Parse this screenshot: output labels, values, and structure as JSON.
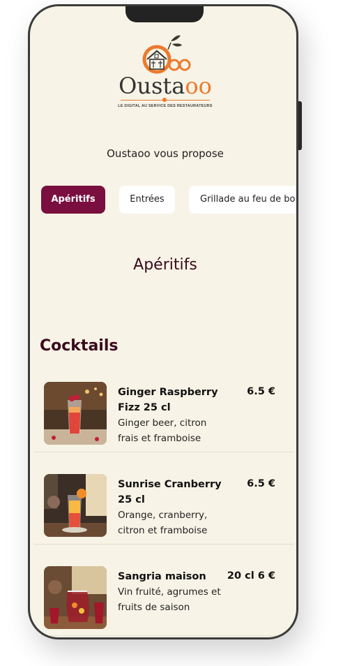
{
  "brand": {
    "name_part1": "Ousta",
    "name_part2": "oo",
    "tagline": "LE DIGITAL AU SERVICE DES RESTAURATEURS"
  },
  "intro": "Oustaoo vous propose",
  "tabs": [
    {
      "label": "Apéritifs",
      "active": true
    },
    {
      "label": "Entrées",
      "active": false
    },
    {
      "label": "Grillade au feu de bo",
      "active": false
    }
  ],
  "section_title": "Apéritifs",
  "category": "Cocktails",
  "items": [
    {
      "name": "Ginger Raspberry Fizz 25 cl",
      "description": "Ginger beer, citron frais et framboise",
      "price": "6.5 €"
    },
    {
      "name": "Sunrise Cranberry 25 cl",
      "description": "Orange, cranberry, citron et framboise",
      "price": "6.5 €"
    },
    {
      "name": "Sangria maison",
      "description": "Vin fruité, agrumes et fruits de saison",
      "price": "20 cl 6 €"
    }
  ],
  "colors": {
    "accent": "#7a0f3f",
    "brand_orange": "#ec7a2d",
    "background": "#f7f3e6"
  }
}
